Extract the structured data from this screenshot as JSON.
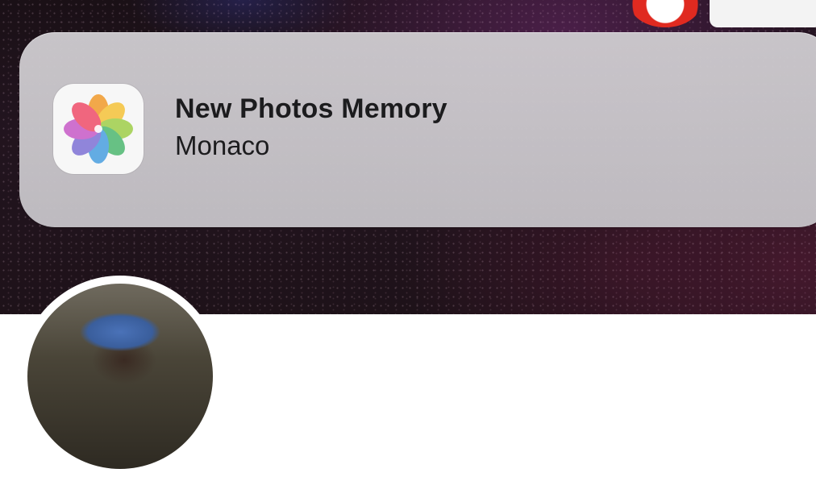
{
  "notification": {
    "app_icon": "photos-app-icon",
    "title": "New Photos Memory",
    "body": "Monaco"
  },
  "background": {
    "accent_colors": [
      "#22141f",
      "#4a1f48",
      "#e02a20",
      "#ffffff"
    ]
  },
  "avatar": {
    "icon": "profile-avatar"
  }
}
